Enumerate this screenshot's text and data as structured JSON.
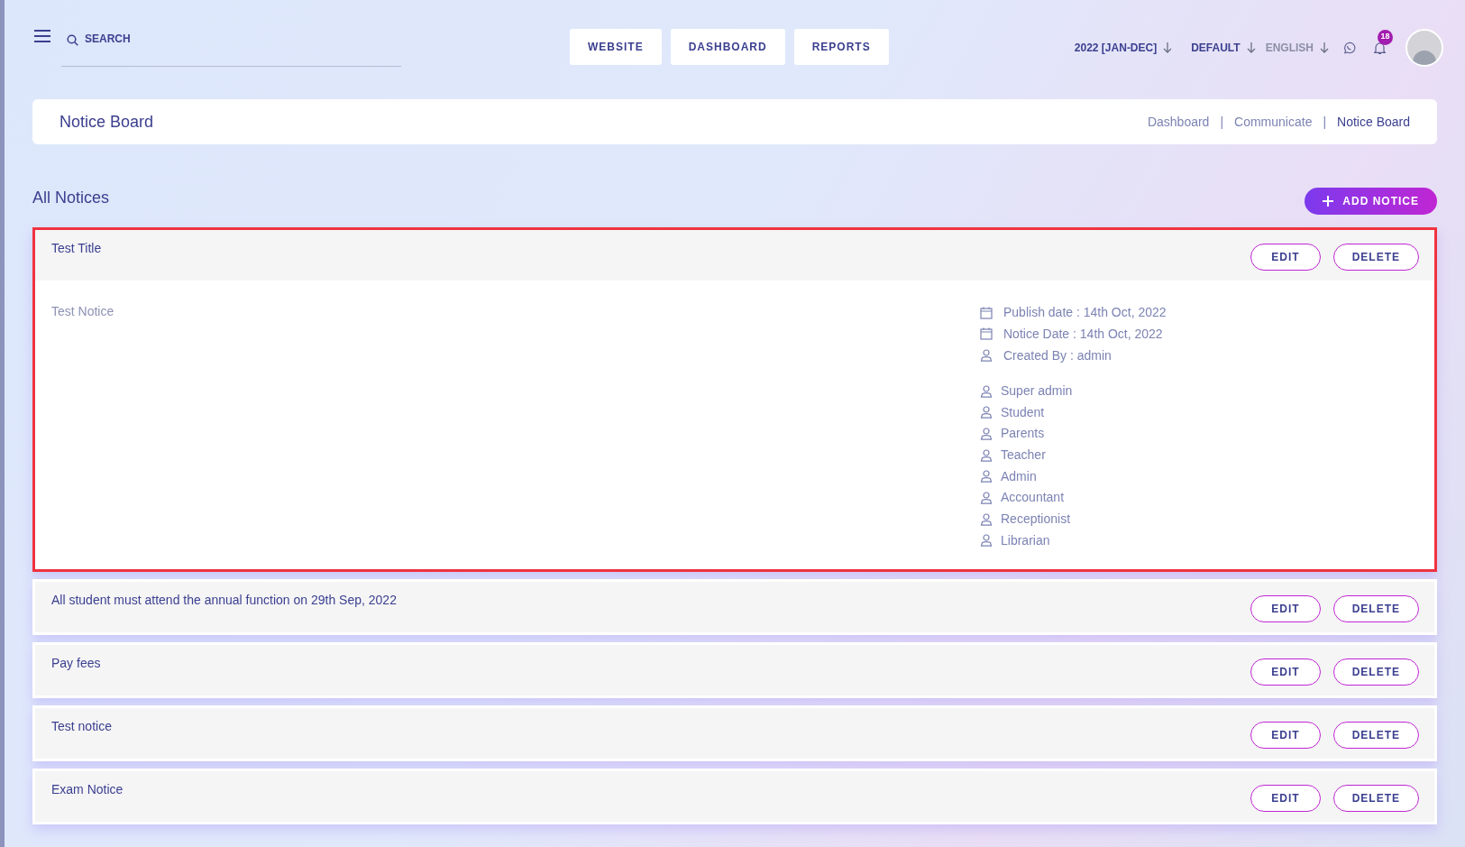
{
  "header": {
    "search": {
      "placeholder": "SEARCH"
    },
    "nav": [
      "WEBSITE",
      "DASHBOARD",
      "REPORTS"
    ],
    "selectors": [
      {
        "label": "2022 [JAN-DEC]",
        "muted": false
      },
      {
        "label": "DEFAULT",
        "muted": false
      },
      {
        "label": "ENGLISH",
        "muted": true
      }
    ],
    "notification_count": "18"
  },
  "page_header": {
    "title": "Notice Board",
    "breadcrumb": [
      {
        "label": "Dashboard",
        "selected": false
      },
      {
        "label": "Communicate",
        "selected": false
      },
      {
        "label": "Notice Board",
        "selected": true
      }
    ],
    "separator": "|"
  },
  "section": {
    "title": "All Notices",
    "add_button": "ADD NOTICE"
  },
  "notices": [
    {
      "title": "Test Title",
      "expanded": true,
      "highlighted": true,
      "body": "Test Notice",
      "actions": [
        "EDIT",
        "DELETE"
      ],
      "meta": [
        {
          "kind": "date",
          "text": "Publish date : 14th Oct, 2022"
        },
        {
          "kind": "date",
          "text": "Notice Date : 14th Oct, 2022"
        },
        {
          "kind": "user",
          "text": "Created By : admin"
        }
      ],
      "audience": [
        "Super admin",
        "Student",
        "Parents",
        "Teacher",
        "Admin",
        "Accountant",
        "Receptionist",
        "Librarian"
      ]
    },
    {
      "title": "All student must attend the annual function on 29th Sep, 2022",
      "expanded": false,
      "highlighted": false,
      "actions": [
        "EDIT",
        "DELETE"
      ]
    },
    {
      "title": "Pay fees",
      "expanded": false,
      "highlighted": false,
      "actions": [
        "EDIT",
        "DELETE"
      ]
    },
    {
      "title": "Test notice",
      "expanded": false,
      "highlighted": false,
      "actions": [
        "EDIT",
        "DELETE"
      ]
    },
    {
      "title": "Exam Notice",
      "expanded": false,
      "highlighted": false,
      "actions": [
        "EDIT",
        "DELETE"
      ]
    }
  ]
}
